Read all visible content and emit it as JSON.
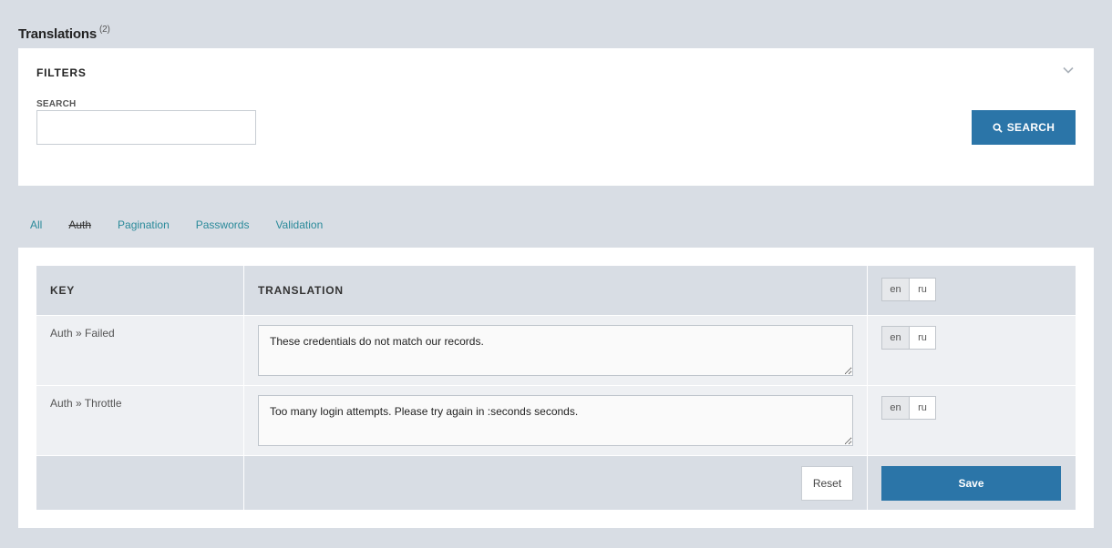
{
  "page": {
    "title": "Translations",
    "count": "(2)"
  },
  "filters": {
    "title": "FILTERS",
    "search_label": "SEARCH",
    "search_value": "",
    "search_button": "SEARCH",
    "collapse_icon": "chevron-down-icon",
    "search_icon": "magnifier-icon"
  },
  "tabs": [
    {
      "label": "All",
      "active": false
    },
    {
      "label": "Auth",
      "active": true
    },
    {
      "label": "Pagination",
      "active": false
    },
    {
      "label": "Passwords",
      "active": false
    },
    {
      "label": "Validation",
      "active": false
    }
  ],
  "table": {
    "headers": {
      "key": "KEY",
      "translation": "TRANSLATION"
    },
    "languages": [
      "en",
      "ru"
    ],
    "selected_language": "en",
    "rows": [
      {
        "key": "Auth » Failed",
        "translation": "These credentials do not match our records."
      },
      {
        "key": "Auth » Throttle",
        "translation": "Too many login attempts. Please try again in :seconds seconds."
      }
    ],
    "reset_label": "Reset",
    "save_label": "Save"
  },
  "colors": {
    "background": "#d8dde4",
    "primary_button": "#2b75a8",
    "tab_link": "#2a8a9a"
  }
}
